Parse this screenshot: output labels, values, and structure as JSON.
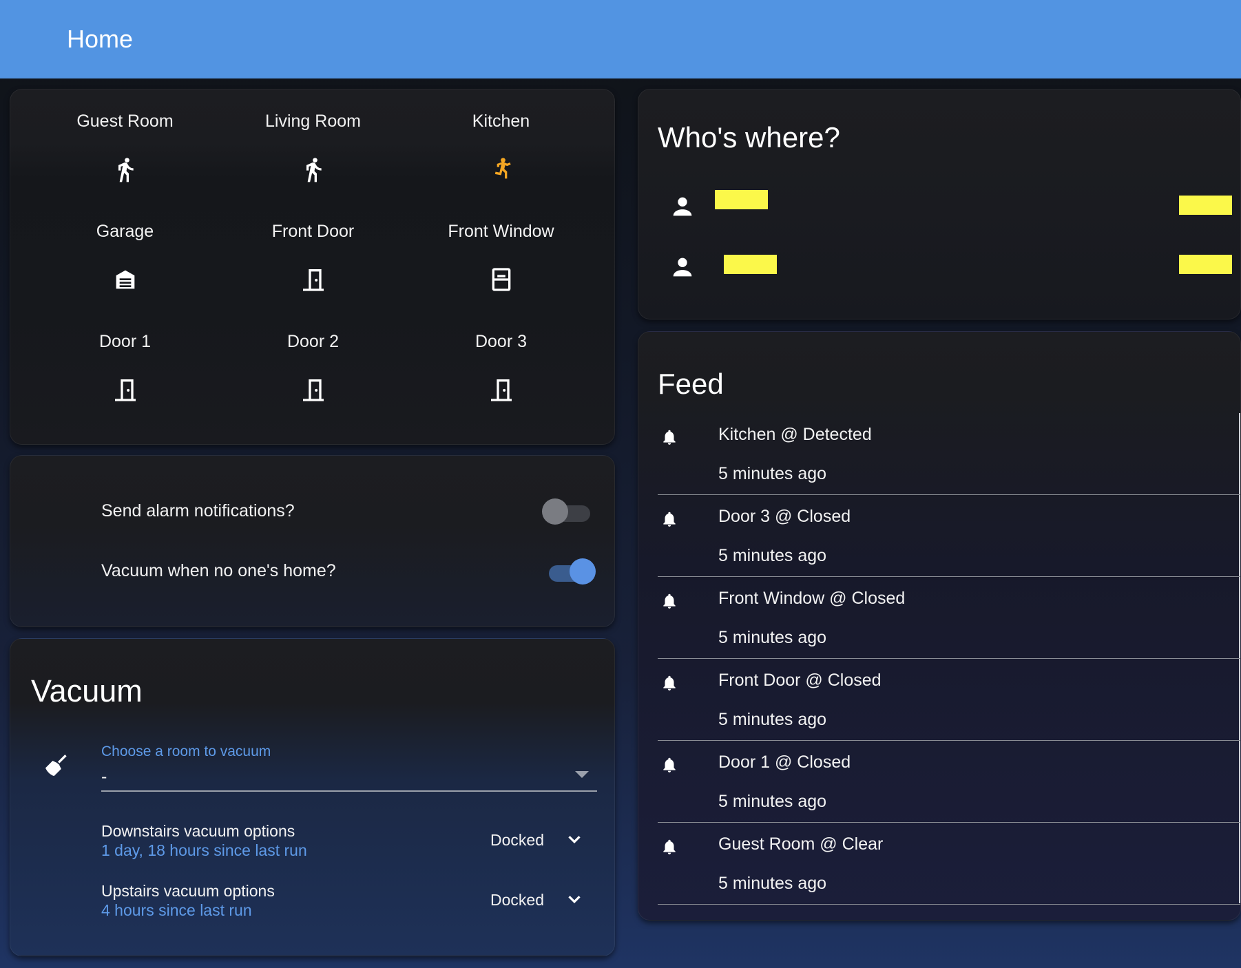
{
  "header": {
    "title": "Home"
  },
  "entities": [
    {
      "label": "Guest Room",
      "icon": "walk-icon",
      "color": "#ffffff"
    },
    {
      "label": "Living Room",
      "icon": "walk-icon",
      "color": "#ffffff"
    },
    {
      "label": "Kitchen",
      "icon": "run-icon",
      "color": "#f4a623"
    },
    {
      "label": "Garage",
      "icon": "garage-icon",
      "color": "#ffffff"
    },
    {
      "label": "Front Door",
      "icon": "door-icon",
      "color": "#ffffff"
    },
    {
      "label": "Front Window",
      "icon": "window-icon",
      "color": "#ffffff"
    },
    {
      "label": "Door 1",
      "icon": "door-icon",
      "color": "#ffffff"
    },
    {
      "label": "Door 2",
      "icon": "door-icon",
      "color": "#ffffff"
    },
    {
      "label": "Door 3",
      "icon": "door-icon",
      "color": "#ffffff"
    }
  ],
  "toggles": {
    "alarm": {
      "label": "Send alarm notifications?",
      "on": false
    },
    "vacuum": {
      "label": "Vacuum when no one's home?",
      "on": true
    }
  },
  "vacuum": {
    "title": "Vacuum",
    "icon": "broom-icon",
    "select": {
      "label": "Choose a room to vacuum",
      "value": "-"
    },
    "rows": [
      {
        "name": "Downstairs vacuum options",
        "sub": "1 day, 18 hours since last run",
        "state": "Docked"
      },
      {
        "name": "Upstairs vacuum options",
        "sub": "4 hours since last run",
        "state": "Docked"
      }
    ]
  },
  "who": {
    "title": "Who's where?",
    "people": [
      {
        "icon": "person-icon",
        "redacted": true
      },
      {
        "icon": "person-icon",
        "redacted": true
      }
    ]
  },
  "feed": {
    "title": "Feed",
    "items": [
      {
        "message": "Kitchen @ Detected",
        "time": "5 minutes ago"
      },
      {
        "message": "Door 3 @ Closed",
        "time": "5 minutes ago"
      },
      {
        "message": "Front Window @ Closed",
        "time": "5 minutes ago"
      },
      {
        "message": "Front Door @ Closed",
        "time": "5 minutes ago"
      },
      {
        "message": "Door 1 @ Closed",
        "time": "5 minutes ago"
      },
      {
        "message": "Guest Room @ Clear",
        "time": "5 minutes ago"
      }
    ]
  },
  "colors": {
    "header": "#5294e2",
    "accent": "#5e9ae8",
    "motion_active": "#f4a623",
    "redaction": "#fbf84a"
  }
}
